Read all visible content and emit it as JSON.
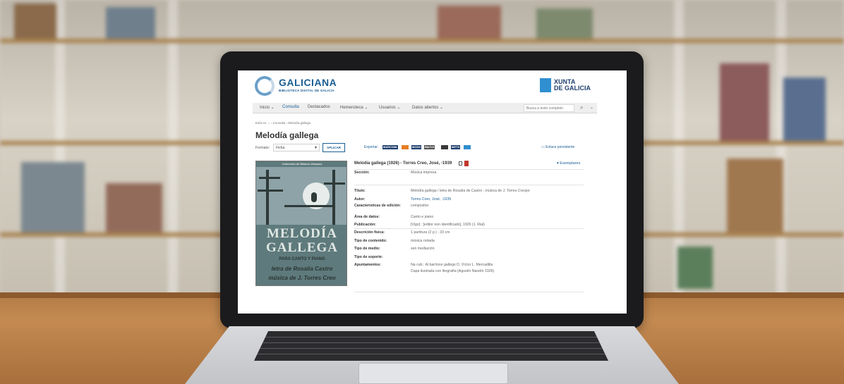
{
  "site": {
    "logo_name": "GALICIANA",
    "logo_subtitle": "BIBLIOTECA DIXITAL DE GALICIA",
    "partner_line1": "XUNTA",
    "partner_line2": "DE GALICIA"
  },
  "nav": {
    "items": [
      {
        "label": "Inicio ⌄"
      },
      {
        "label": "Consulta"
      },
      {
        "label": "Destacados"
      },
      {
        "label": "Hemeroteca ⌄"
      },
      {
        "label": "Usuarios ⌄"
      },
      {
        "label": "Datos abertos ⌄"
      }
    ],
    "active_index": 1,
    "search_placeholder": "Busca a texto completo"
  },
  "breadcrumb": "Está en: ⌂ › Consulta › Melodía gallega",
  "page_title": "Melodía gallega",
  "toolbar": {
    "format_label": "Formato:",
    "format_value": "Ficha",
    "apply_label": "APLICAR",
    "export_label": "Exportar:",
    "export_formats": [
      {
        "label": "MARCXML",
        "color": "#1f3f6e"
      },
      {
        "label": "",
        "color": "#e67e22"
      },
      {
        "label": "MODS",
        "color": "#1f3f6e"
      },
      {
        "label": "BibTeX",
        "color": "#555555"
      },
      {
        "label": "",
        "color": "#3a3a3a"
      },
      {
        "label": "METS",
        "color": "#1f3f6e"
      },
      {
        "label": "",
        "color": "#2f8fd0"
      }
    ],
    "permalink_label": "▭ Enlace persistente"
  },
  "cover": {
    "top_text": "Colección de Blanco-Vázquez",
    "title_line1": "MELODÍA",
    "title_line2": "GALLEGA",
    "subtitle": "PARA CANTO Y PIANO",
    "line_a": "letra de Rosalía Castro",
    "line_b": "música de J. Torres Creo",
    "colors": {
      "sky": "#8da3a8",
      "band": "#5e7a7c",
      "tree": "#2e3a38"
    }
  },
  "record": {
    "heading": "Melodía gallega (1926) - Torres Creo, José, -1939",
    "copies_label": "▾ Exemplares",
    "fields": [
      {
        "label": "Sección:",
        "value": "Música impresa",
        "link": false
      },
      {
        "label": "Título:",
        "value": "Melodía gallega / letra de Rosalía de Castro ; música de J. Torres Crespo",
        "link": false
      },
      {
        "label": "Autor:",
        "value": "Torres Creo, José, -1939",
        "link": true
      },
      {
        "label": "Características de edición:",
        "value": "compositor",
        "link": false
      },
      {
        "label": "Área de datos:",
        "value": "Canto e piano",
        "link": false
      },
      {
        "label": "Publicación:",
        "value": "[Vigo] : [editor non identificado], 1926 (J. Rial)",
        "link": false
      },
      {
        "label": "Descrición física:",
        "value": "1 partitura (2 p.) ; 33 cm",
        "link": false
      },
      {
        "label": "Tipo de contenido:",
        "value": "música notada",
        "link": false
      },
      {
        "label": "Tipo de medio:",
        "value": "sen mediación",
        "link": false
      },
      {
        "label": "Tipo de soporte:",
        "value": "",
        "link": false
      },
      {
        "label": "Apuntamentos:",
        "value": "Na cub.: Al barítono gallego D. Víctor L. Mercadilla",
        "link": false
      },
      {
        "label": "",
        "value": "Capa ilustrada con litografía (Agustín Nandín 1926)",
        "link": false
      }
    ]
  }
}
